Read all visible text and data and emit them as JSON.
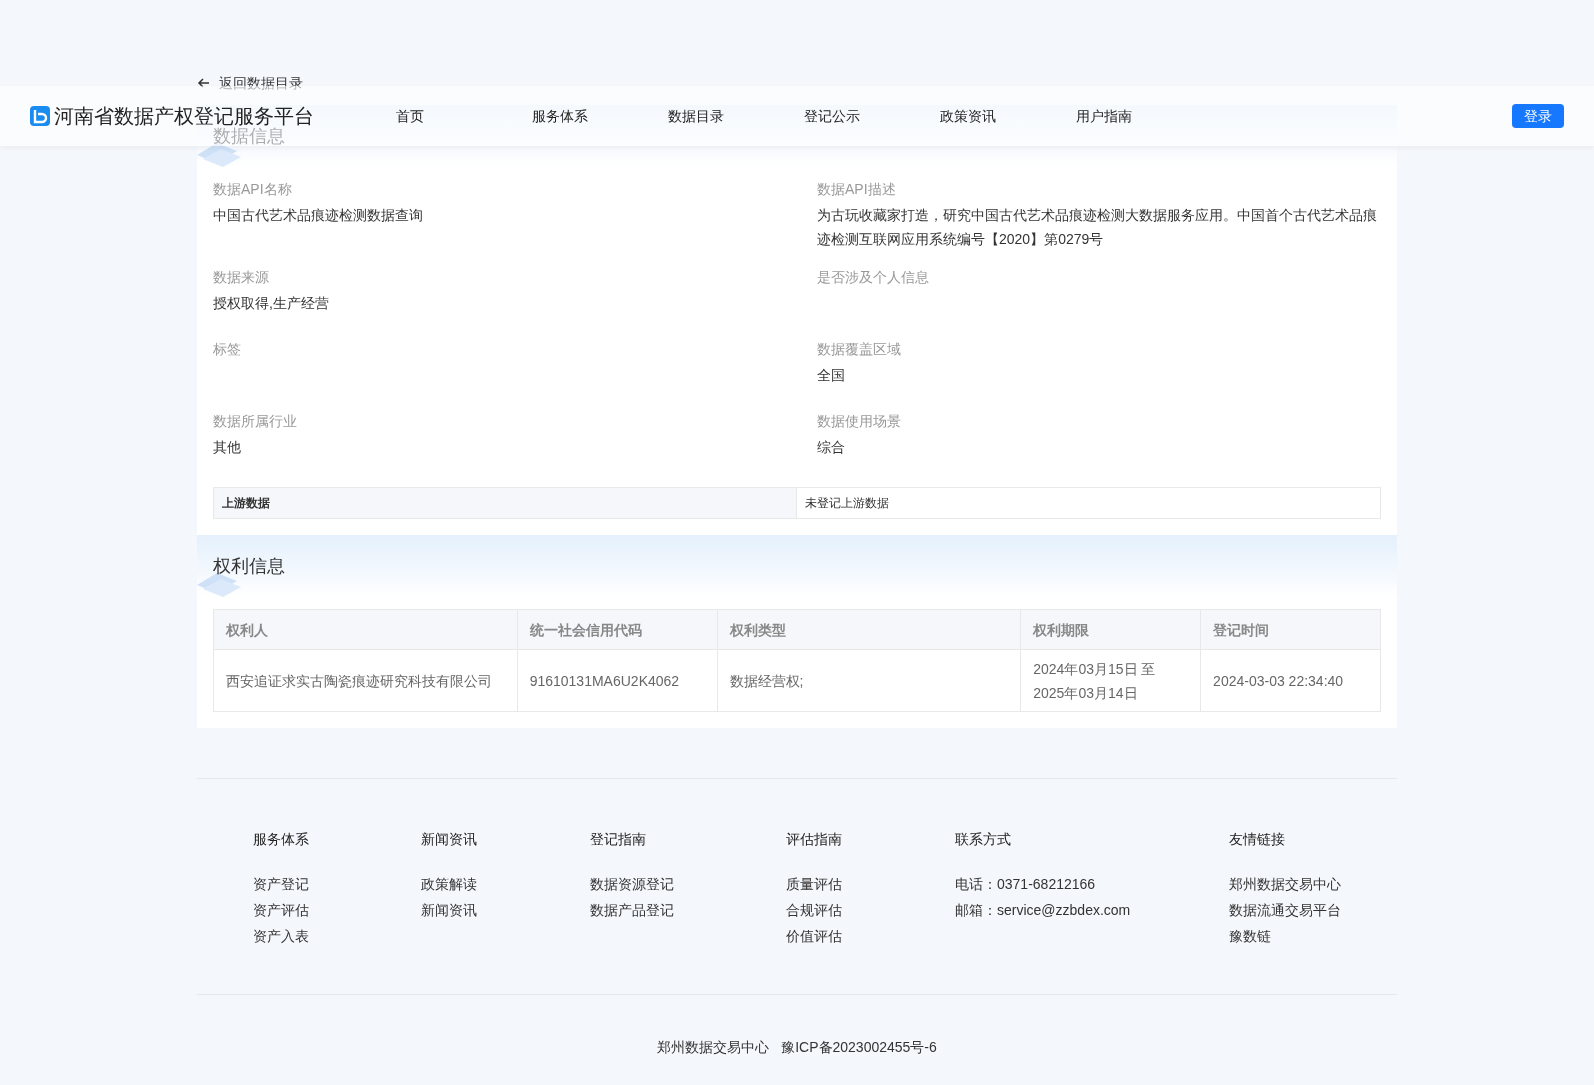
{
  "back_link": "返回数据目录",
  "header": {
    "logo_text": "河南省数据产权登记服务平台",
    "nav": [
      {
        "label": "首页",
        "selected": false
      },
      {
        "label": "服务体系",
        "selected": false
      },
      {
        "label": "数据目录",
        "selected": false
      },
      {
        "label": "登记公示",
        "selected": false
      },
      {
        "label": "政策资讯",
        "selected": false
      },
      {
        "label": "用户指南",
        "selected": false
      }
    ],
    "login_button": "登录"
  },
  "data_info": {
    "title": "数据信息",
    "fields": [
      {
        "label": "数据API名称",
        "value": "中国古代艺术品痕迹检测数据查询"
      },
      {
        "label": "数据API描述",
        "value": "为古玩收藏家打造，研究中国古代艺术品痕迹检测大数据服务应用。中国首个古代艺术品痕迹检测互联网应用系统编号【2020】第0279号"
      },
      {
        "label": "数据来源",
        "value": "授权取得,生产经营"
      },
      {
        "label": "是否涉及个人信息"
      },
      {
        "label": "标签"
      },
      {
        "label": "数据覆盖区域",
        "value": "全国"
      },
      {
        "label": "数据所属行业",
        "value": "其他"
      },
      {
        "label": "数据使用场景",
        "value": "综合"
      }
    ],
    "upstream": {
      "label": "上游数据",
      "value": "未登记上游数据"
    }
  },
  "rights_info": {
    "title": "权利信息",
    "columns": [
      "权利人",
      "统一社会信用代码",
      "权利类型",
      "权利期限",
      "登记时间"
    ],
    "rows": [
      [
        "西安追证求实古陶瓷痕迹研究科技有限公司",
        "91610131MA6U2K4062",
        "数据经营权;",
        "2024年03月15日 至 2025年03月14日",
        "2024-03-03 22:34:40"
      ]
    ]
  },
  "footer": {
    "columns": [
      {
        "heading": "服务体系",
        "links": [
          "资产登记",
          "资产评估",
          "资产入表"
        ]
      },
      {
        "heading": "新闻资讯",
        "links": [
          "政策解读",
          "新闻资讯"
        ]
      },
      {
        "heading": "登记指南",
        "links": [
          "数据资源登记",
          "数据产品登记"
        ]
      },
      {
        "heading": "评估指南",
        "links": [
          "质量评估",
          "合规评估",
          "价值评估"
        ]
      },
      {
        "heading": "联系方式",
        "links": [
          "电话：0371-68212166",
          "邮箱：service@zzbdex.com"
        ]
      },
      {
        "heading": "友情链接",
        "links": [
          "郑州数据交易中心",
          "数据流通交易平台",
          "豫数链"
        ]
      }
    ],
    "copyright": [
      "郑州数据交易中心",
      "豫ICP备2023002455号-6"
    ]
  }
}
